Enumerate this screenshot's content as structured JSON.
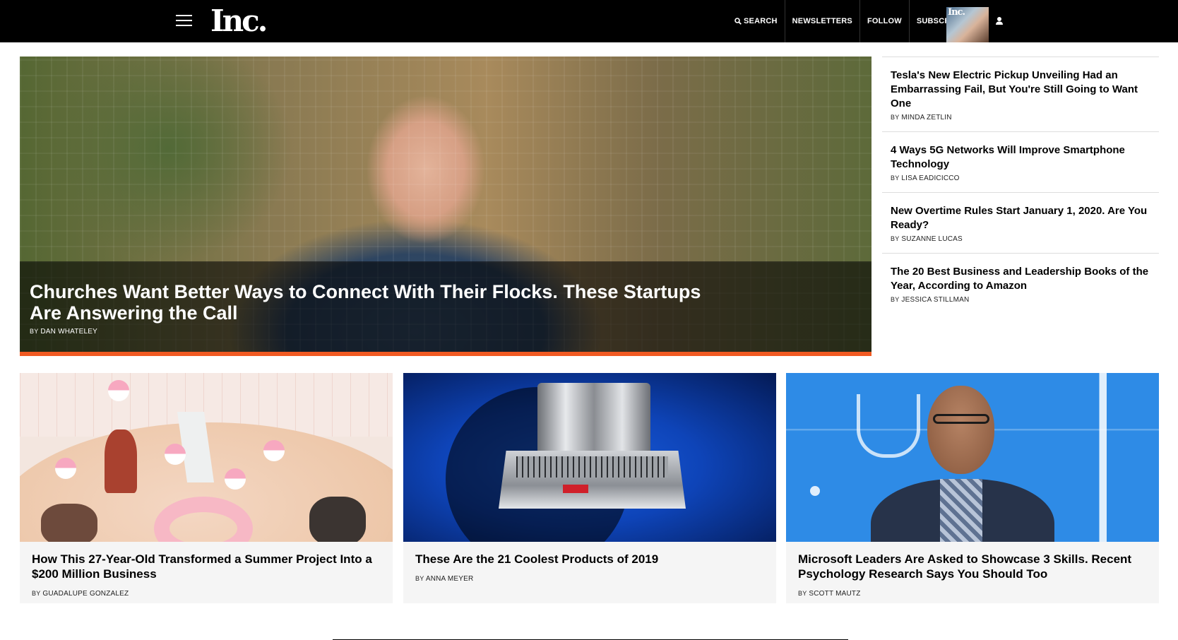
{
  "header": {
    "logo": "Inc.",
    "nav": [
      {
        "label": "SEARCH",
        "icon": "search-icon"
      },
      {
        "label": "NEWSLETTERS"
      },
      {
        "label": "FOLLOW"
      },
      {
        "label": "SUBSCRIBE"
      }
    ],
    "promo_tag": "Inc.",
    "icons": [
      "hamburger-menu-icon",
      "user-icon"
    ]
  },
  "hero": {
    "title": "Churches Want Better Ways to Connect With Their Flocks. These Startups Are Answering the Call",
    "by": "BY",
    "author": "DAN WHATELEY",
    "accent_color": "#f15a22"
  },
  "sidebar": {
    "items": [
      {
        "title": "Tesla's New Electric Pickup Unveiling Had an Embarrassing Fail, But You're Still Going to Want One",
        "by": "BY",
        "author": "MINDA ZETLIN"
      },
      {
        "title": "4 Ways 5G Networks Will Improve Smartphone Technology",
        "by": "BY",
        "author": "LISA EADICICCO"
      },
      {
        "title": "New Overtime Rules Start January 1, 2020. Are You Ready?",
        "by": "BY",
        "author": "SUZANNE LUCAS"
      },
      {
        "title": "The 20 Best Business and Leadership Books of the Year, According to Amazon",
        "by": "BY",
        "author": "JESSICA STILLMAN"
      }
    ]
  },
  "cards": [
    {
      "title": "How This 27-Year-Old Transformed a Summer Project Into a $200 Million Business",
      "by": "BY",
      "author": "GUADALUPE GONZALEZ"
    },
    {
      "title": "These Are the 21 Coolest Products of 2019",
      "by": "BY",
      "author": "ANNA MEYER"
    },
    {
      "title": "Microsoft Leaders Are Asked to Showcase 3 Skills. Recent Psychology Research Says You Should Too",
      "by": "BY",
      "author": "SCOTT MAUTZ"
    }
  ]
}
